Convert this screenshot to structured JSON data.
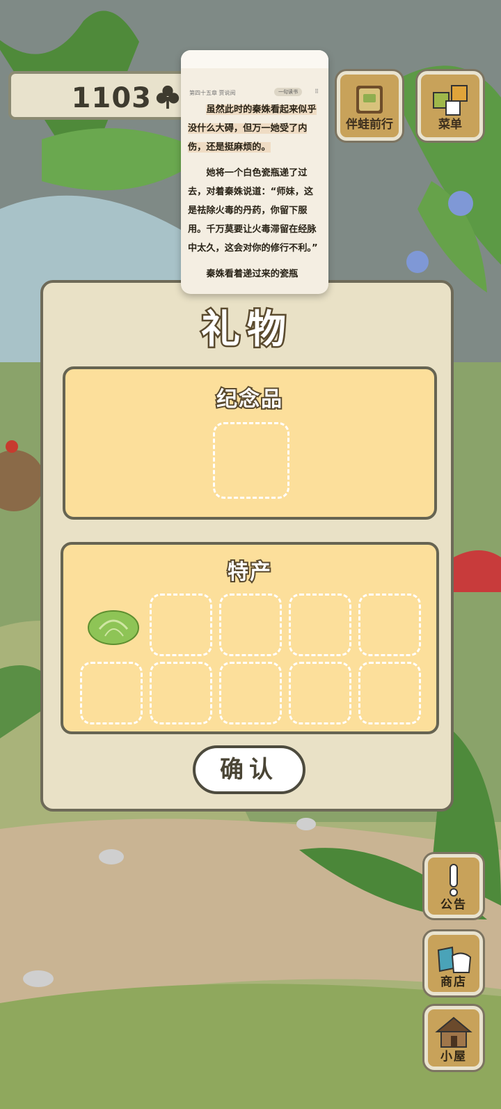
{
  "counter": {
    "value": "1103",
    "icon": "clover-icon"
  },
  "top_buttons": [
    {
      "label": "伴蛙前行",
      "icon": "journal-icon"
    },
    {
      "label": "菜单",
      "icon": "menu-cards-icon"
    }
  ],
  "reader": {
    "chapter": "第四十五章 贾说阅",
    "pill": "一句读书",
    "paragraphs": [
      "虽然此时的秦姝看起来似乎没什么大碍，但万一她受了内伤，还是挺麻烦的。",
      "她将一个白色瓷瓶递了过去，对着秦姝说道：“师妹，这是祛除火毒的丹药，你留下服用。千万莫要让火毒滞留在经脉中太久，这会对你的修行不利。”",
      "秦姝看着递过来的瓷瓶"
    ]
  },
  "dialog": {
    "title": "礼物",
    "souvenir": {
      "title": "纪念品",
      "slots": 1
    },
    "specialty": {
      "title": "特产",
      "items": [
        "cabbage-icon"
      ],
      "slots": 10
    },
    "confirm_label": "确认"
  },
  "side_buttons": [
    {
      "label": "公告",
      "icon": "exclamation-icon"
    },
    {
      "label": "商店",
      "icon": "shop-bags-icon"
    },
    {
      "label": "小屋",
      "icon": "house-icon"
    }
  ],
  "colors": {
    "panel_fill": "#fcdf9b",
    "dialog_fill": "#e9e1c6",
    "wood": "#c8a25a"
  }
}
